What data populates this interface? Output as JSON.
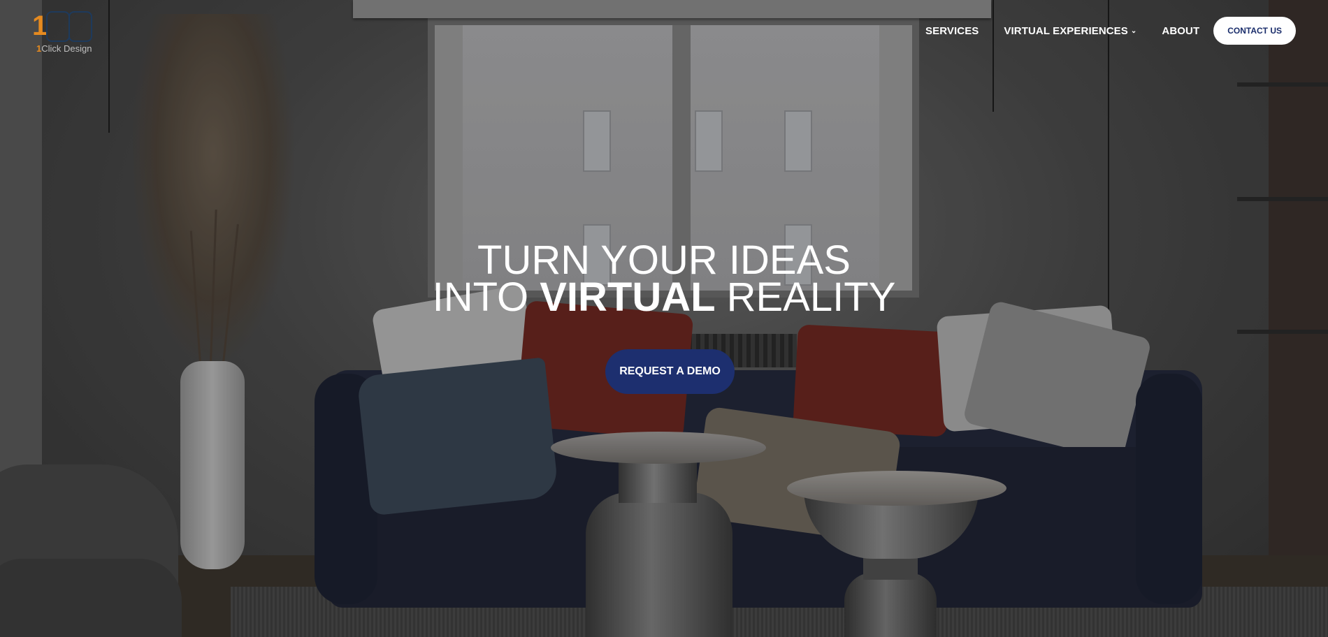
{
  "logo": {
    "digit": "1",
    "text_one": "1",
    "text_rest": "Click Design"
  },
  "nav": {
    "items": [
      {
        "label": "SERVICES"
      },
      {
        "label": "VIRTUAL EXPERIENCES",
        "has_dropdown": true,
        "dropdown_icon": "chevron-down-icon"
      },
      {
        "label": "ABOUT"
      }
    ],
    "contact_label": "CONTACT US"
  },
  "hero": {
    "line1": "TURN YOUR IDEAS",
    "line2_prefix": "INTO",
    "line2_bold": "VIRTUAL",
    "line2_suffix": "REALITY",
    "cta_label": "REQUEST A DEMO"
  },
  "colors": {
    "cta_background": "#1d2f6f",
    "contact_text": "#1a2d6b",
    "logo_accent": "#e58a20",
    "logo_box": "#1e3a5c"
  }
}
